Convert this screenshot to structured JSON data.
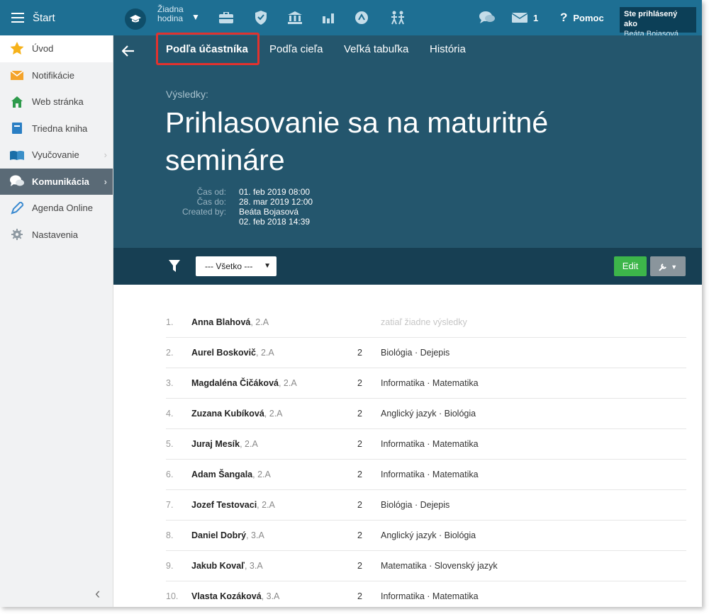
{
  "topbar": {
    "app_title": "Štart",
    "hour_line1": "Žiadna",
    "hour_line2": "hodina",
    "messages_count": "1",
    "help_label": "Pomoc",
    "user_line1": "Ste prihlásený ako",
    "user_line2": "Beáta Bojasová",
    "icons": [
      "briefcase-icon",
      "shield-icon",
      "bank-icon",
      "bar-chart-icon",
      "badge-icon",
      "walking-people-icon",
      "chat-icon",
      "envelope-icon",
      "question-icon"
    ]
  },
  "sidebar": {
    "items": [
      {
        "label": "Úvod",
        "icon": "star-icon"
      },
      {
        "label": "Notifikácie",
        "icon": "envelope-icon"
      },
      {
        "label": "Web stránka",
        "icon": "home-icon"
      },
      {
        "label": "Triedna kniha",
        "icon": "book-icon"
      },
      {
        "label": "Vyučovanie",
        "icon": "open-book-icon"
      },
      {
        "label": "Komunikácia",
        "icon": "chat-icon"
      },
      {
        "label": "Agenda Online",
        "icon": "pencil-icon"
      },
      {
        "label": "Nastavenia",
        "icon": "gear-icon"
      }
    ],
    "collapse_label": "‹"
  },
  "tabs": [
    {
      "label": "Podľa účastníka"
    },
    {
      "label": "Podľa cieľa"
    },
    {
      "label": "Veľká tabuľka"
    },
    {
      "label": "História"
    }
  ],
  "header": {
    "results_label": "Výsledky:",
    "title": "Prihlasovanie sa na maturitné semináre",
    "meta": {
      "from_key": "Čas od:",
      "from_val": "01. feb 2019 08:00",
      "to_key": "Čas do:",
      "to_val": "28. mar 2019 12:00",
      "created_key": "Created by:",
      "created_val": "Beáta Bojasová",
      "created_date": "02. feb 2018 14:39"
    }
  },
  "toolbar": {
    "filter_value": "--- Všetko ---",
    "edit_label": "Edit"
  },
  "rows": [
    {
      "num": "1.",
      "name": "Anna Blahová",
      "cls": ", 2.A",
      "count": "",
      "subjects": "zatiaľ žiadne výsledky",
      "empty": true
    },
    {
      "num": "2.",
      "name": "Aurel Boskovič",
      "cls": ", 2.A",
      "count": "2",
      "subjects": "Biológia · Dejepis"
    },
    {
      "num": "3.",
      "name": "Magdaléna Čičáková",
      "cls": ", 2.A",
      "count": "2",
      "subjects": "Informatika · Matematika"
    },
    {
      "num": "4.",
      "name": "Zuzana Kubíková",
      "cls": ", 2.A",
      "count": "2",
      "subjects": "Anglický jazyk · Biológia"
    },
    {
      "num": "5.",
      "name": "Juraj Mesík",
      "cls": ", 2.A",
      "count": "2",
      "subjects": "Informatika · Matematika"
    },
    {
      "num": "6.",
      "name": "Adam Šangala",
      "cls": ", 2.A",
      "count": "2",
      "subjects": "Informatika · Matematika"
    },
    {
      "num": "7.",
      "name": "Jozef Testovaci",
      "cls": ", 2.A",
      "count": "2",
      "subjects": "Biológia · Dejepis"
    },
    {
      "num": "8.",
      "name": "Daniel Dobrý",
      "cls": ", 3.A",
      "count": "2",
      "subjects": "Anglický jazyk · Biológia"
    },
    {
      "num": "9.",
      "name": "Jakub Kovaľ",
      "cls": ", 3.A",
      "count": "2",
      "subjects": "Matematika · Slovenský jazyk"
    },
    {
      "num": "10.",
      "name": "Vlasta Kozáková",
      "cls": ", 3.A",
      "count": "2",
      "subjects": "Informatika · Matematika"
    }
  ]
}
